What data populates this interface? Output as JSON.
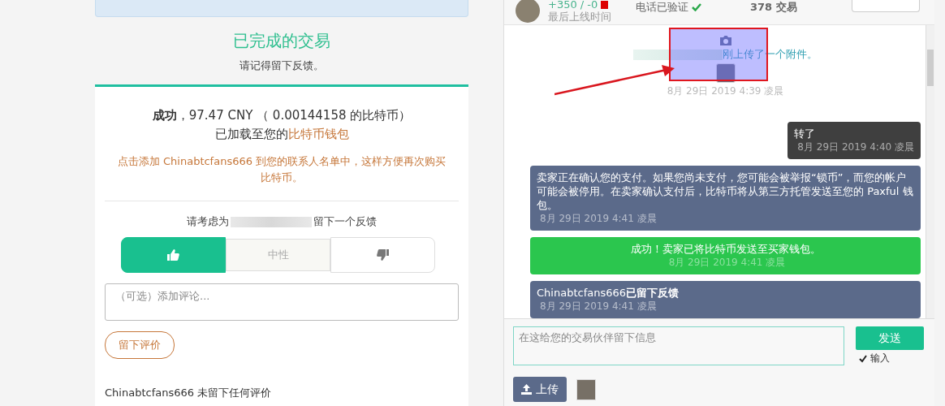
{
  "completed": {
    "title": "已完成的交易",
    "subtitle": "请记得留下反馈。"
  },
  "result": {
    "line1": "**成功**，97.47 CNY （ 0.00144158 的比特币）",
    "line2": "已加载至您的",
    "wallet_link": "比特币钱包",
    "contact_hint": "点击添加 Chinabtcfans666 到您的联系人名单中，这样方便再次购买比特币。"
  },
  "feedback": {
    "prompt_before": "请考虑为",
    "prompt_after": "留下一个反馈",
    "options": [
      {
        "kind": "positive",
        "selected": true
      },
      {
        "kind": "neutral",
        "label": "中性",
        "selected": false
      },
      {
        "kind": "negative",
        "selected": false
      }
    ],
    "comment_placeholder": "（可选）添加评论...",
    "submit": "留下评价",
    "partner_status": "Chinabtcfans666 未留下任何评价"
  },
  "trader": {
    "score": "+350 / -0",
    "last_seen": "最后上线时间",
    "phone": "电话已验证",
    "trades": "378 交易"
  },
  "messages": [
    {
      "kind": "attachment",
      "text": "刚上传了一个附件。",
      "time": "8月 29日 2019 4:39 凌晨"
    },
    {
      "kind": "own",
      "text": "转了",
      "time": "8月 29日 2019 4:40 凌晨"
    },
    {
      "kind": "info",
      "text": "卖家正在确认您的支付。如果您尚未支付，您可能会被举报“锁币”，而您的帐户可能会被停用。在卖家确认支付后，比特币将从第三方托管发送至您的 Paxful 钱包。",
      "time": "8月 29日 2019 4:41 凌晨"
    },
    {
      "kind": "success",
      "text": "成功！卖家已将比特币发送至买家钱包。",
      "time": "8月 29日 2019 4:41 凌晨"
    },
    {
      "kind": "info",
      "text": "Chinabtcfans666**已留下反馈**",
      "time": "8月 29日 2019 4:41 凌晨"
    }
  ],
  "composer": {
    "placeholder": "在这给您的交易伙伴留下信息",
    "send": "发送",
    "enter_to_send": {
      "label": "输入",
      "checked": true
    },
    "upload": "上传"
  }
}
